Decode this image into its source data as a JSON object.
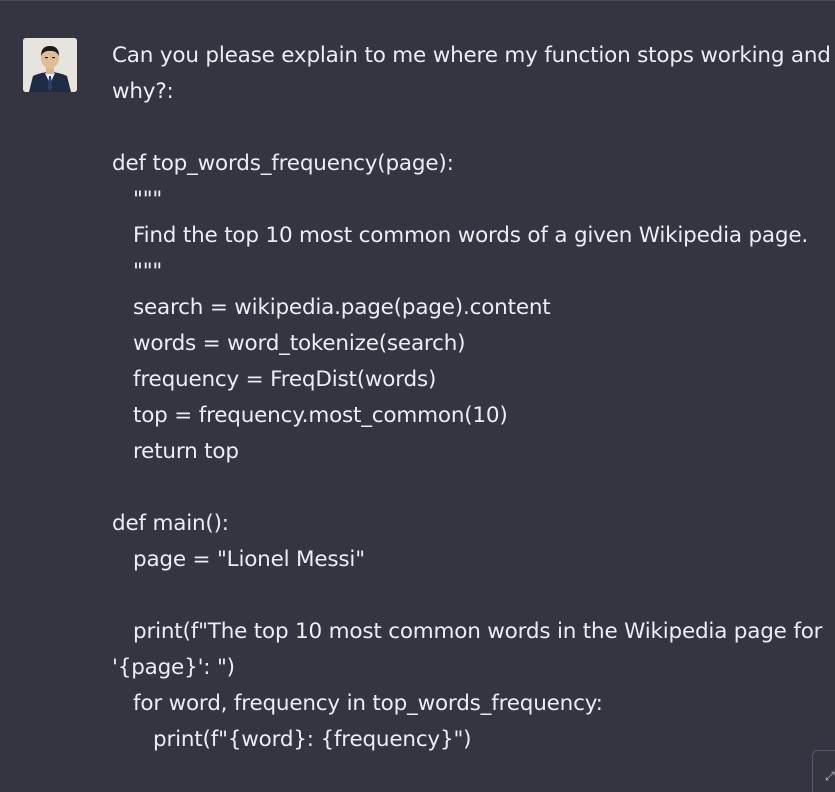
{
  "message": {
    "lines": [
      "Can you please explain to me where my function stops working and",
      "why?:",
      "",
      "def top_words_frequency(page):",
      "\"\"\"",
      "Find the top 10 most common words of a given Wikipedia page.",
      "\"\"\"",
      "search = wikipedia.page(page).content",
      "words = word_tokenize(search)",
      "frequency = FreqDist(words)",
      "top = frequency.most_common(10)",
      "return top",
      "",
      "def main():",
      "page = \"Lionel Messi\"",
      "",
      "print(f\"The top 10 most common words in the Wikipedia page for",
      "'{page}': \")",
      "for word, frequency in top_words_frequency:",
      "print(f\"{word}: {frequency}\")"
    ]
  },
  "icons": {
    "avatar": "user-avatar",
    "side_control": "expand-icon"
  }
}
